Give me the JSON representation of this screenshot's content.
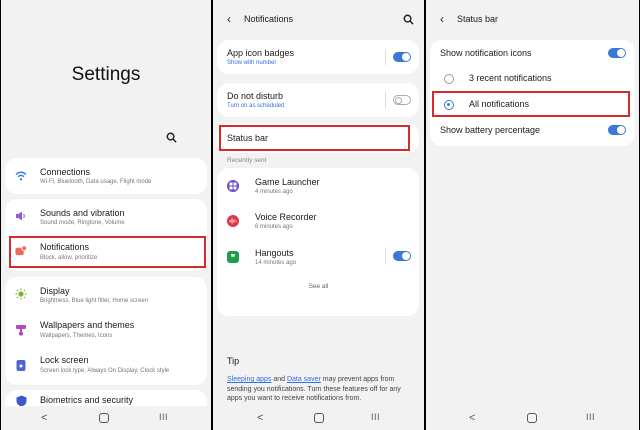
{
  "panel1": {
    "title": "Settings",
    "items": [
      {
        "label": "Connections",
        "sub": "Wi-Fi, Bluetooth, Data usage, Flight mode",
        "color": "#2f7ae5"
      },
      {
        "label": "Sounds and vibration",
        "sub": "Sound mode, Ringtone, Volume",
        "color": "#8f5ed6"
      },
      {
        "label": "Notifications",
        "sub": "Block, allow, prioritize",
        "color": "#f06a55"
      },
      {
        "label": "Display",
        "sub": "Brightness, Blue light filter, Home screen",
        "color": "#77b42e"
      },
      {
        "label": "Wallpapers and themes",
        "sub": "Wallpapers, Themes, Icons",
        "color": "#b546c4"
      },
      {
        "label": "Lock screen",
        "sub": "Screen lock type, Always On Display, Clock style",
        "color": "#5066d6"
      },
      {
        "label": "Biometrics and security",
        "sub": "",
        "color": "#3c58c9"
      }
    ]
  },
  "panel2": {
    "header": "Notifications",
    "app_icon_badges": {
      "label": "App icon badges",
      "sub": "Show with number",
      "on": true
    },
    "do_not_disturb": {
      "label": "Do not disturb",
      "sub": "Turn on as scheduled",
      "on": false
    },
    "status_bar": "Status bar",
    "recently_sent": "Recently sent",
    "apps": [
      {
        "name": "Game Launcher",
        "time": "4 minutes ago",
        "color": "#6a4fc8"
      },
      {
        "name": "Voice Recorder",
        "time": "6 minutes ago",
        "color": "#e2374a"
      },
      {
        "name": "Hangouts",
        "time": "14 minutes ago",
        "color": "#1e9e4a",
        "on": true
      }
    ],
    "see_all": "See all",
    "tip_title": "Tip",
    "tip_link1": "Sleeping apps",
    "tip_and": " and ",
    "tip_link2": "Data saver",
    "tip_text": " may prevent apps from sending you notifications. Turn these features off for any apps you want to receive notifications from."
  },
  "panel3": {
    "header": "Status bar",
    "show_icons": {
      "label": "Show notification icons",
      "on": true
    },
    "options": [
      {
        "label": "3 recent notifications",
        "selected": false
      },
      {
        "label": "All notifications",
        "selected": true
      }
    ],
    "battery": {
      "label": "Show battery percentage",
      "on": true
    }
  },
  "nav": {
    "back": "<",
    "home": "O",
    "recent": "III"
  }
}
